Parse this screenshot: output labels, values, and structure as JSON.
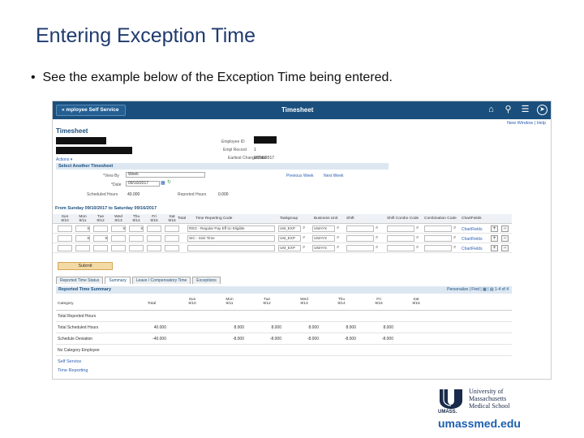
{
  "slide": {
    "title": "Entering Exception Time",
    "bullet_marker": "•",
    "bullet_text": "See the example below of the Exception Time being entered."
  },
  "app": {
    "back_button": "« mployee Self Service",
    "title": "Timesheet",
    "icons": [
      "home-icon",
      "search-icon",
      "menu-icon",
      "navbar-icon"
    ],
    "new_window": "New Window",
    "help": "Help",
    "page_title": "Timesheet"
  },
  "employee": {
    "id_label": "Employee ID",
    "record_label": "Empl Record",
    "record_value": "1",
    "earliest_label": "Earliest Change Date",
    "earliest_value": "08/06/2017"
  },
  "actions_label": "Actions ▾",
  "select_timesheet": {
    "header": "Select Another Timesheet",
    "view_by_label": "*View By",
    "view_by_value": "Week",
    "date_label": "*Date",
    "date_value": "09/10/2017",
    "prev_week": "Previous Week",
    "next_week": "Next Week",
    "scheduled_label": "Scheduled Hours",
    "scheduled_value": "40.000",
    "reported_label": "Reported Hours",
    "reported_value": "0.000"
  },
  "week_header": "From Sunday 09/10/2017 to Saturday 09/16/2017",
  "grid": {
    "days": [
      {
        "d": "Sun",
        "n": "9/10"
      },
      {
        "d": "Mon",
        "n": "9/11"
      },
      {
        "d": "Tue",
        "n": "9/12"
      },
      {
        "d": "Wed",
        "n": "9/13"
      },
      {
        "d": "Thu",
        "n": "9/14"
      },
      {
        "d": "Fri",
        "n": "9/15"
      },
      {
        "d": "Sat",
        "n": "9/16"
      }
    ],
    "columns": [
      "Total",
      "Time Reporting Code",
      "Taskgroup",
      "Business Unit",
      "Shift",
      "Shift Combo Code",
      "Combination Code",
      "ChartFields"
    ],
    "rows": [
      {
        "cells": [
          "",
          "8",
          "",
          "8",
          "8",
          "",
          ""
        ],
        "trc": "REG - Regular Pay Eff ILI Eligible",
        "taskgroup": "UM_EXP",
        "bu": "UMAYS",
        "chart": "ChartFields"
      },
      {
        "cells": [
          "",
          "8",
          "8",
          "",
          "",
          "",
          ""
        ],
        "trc": "SIC - Sick Time",
        "taskgroup": "UM_EXP",
        "bu": "UMAYS",
        "chart": "ChartFields"
      },
      {
        "cells": [
          "",
          "",
          "",
          "",
          "",
          "",
          ""
        ],
        "trc": "",
        "taskgroup": "UM_EXP",
        "bu": "UMAYS",
        "chart": "ChartFields"
      }
    ]
  },
  "submit_label": "Submit",
  "tabs": [
    "Reported Time Status",
    "Summary",
    "Leave / Compensatory Time",
    "Exceptions"
  ],
  "summary": {
    "header": "Reported Time Summary",
    "links": "Personalize | Find | ▦ | ▤    1-4 of 4",
    "columns": [
      {
        "d": "Category",
        "n": ""
      },
      {
        "d": "Total",
        "n": ""
      },
      {
        "d": "Sun",
        "n": "9/10"
      },
      {
        "d": "Mon",
        "n": "9/11"
      },
      {
        "d": "Tue",
        "n": "9/12"
      },
      {
        "d": "Wed",
        "n": "9/13"
      },
      {
        "d": "Thu",
        "n": "9/14"
      },
      {
        "d": "Fri",
        "n": "9/15"
      },
      {
        "d": "Sat",
        "n": "9/16"
      }
    ],
    "rows": [
      {
        "label": "Total Reported Hours",
        "values": [
          "",
          "",
          "",
          "",
          "",
          "",
          "",
          ""
        ]
      },
      {
        "label": "Total Scheduled Hours",
        "values": [
          "40.000",
          "",
          "8.000",
          "8.000",
          "8.000",
          "8.000",
          "8.000",
          ""
        ]
      },
      {
        "label": "Schedule Deviation",
        "values": [
          "-40.000",
          "",
          "-8.000",
          "-8.000",
          "-8.000",
          "-8.000",
          "-8.000",
          ""
        ]
      },
      {
        "label": "No Category Employee",
        "values": [
          "",
          "",
          "",
          "",
          "",
          "",
          "",
          ""
        ]
      }
    ]
  },
  "bottom_links": [
    "Self Service",
    "Time Reporting"
  ],
  "logo": {
    "line1": "University of",
    "line2": "Massachusetts",
    "line3": "Medical School",
    "umass": "UMASS.",
    "url": "umassmed.edu"
  }
}
